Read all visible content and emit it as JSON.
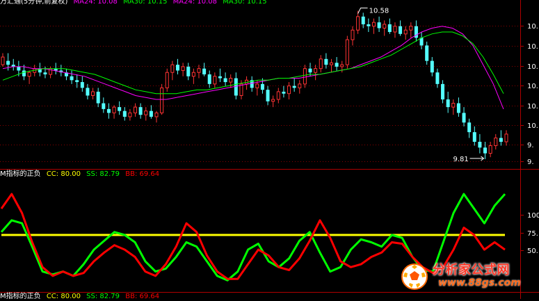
{
  "colors": {
    "up": "#ff3333",
    "down": "#54ffff",
    "ma24": "#ff00ff",
    "ma30": "#00ff00",
    "axis": "#b00000",
    "grid": "#8b0000",
    "cc": "#ffff00",
    "ss": "#00ff00",
    "bb": "#ff0000",
    "label": "#ffffff"
  },
  "price_panel": {
    "title": "万汇通(5分钟,前复权)",
    "legend": [
      {
        "label": "MA24: 10.08",
        "color": "#ff00ff",
        "key": "ma24"
      },
      {
        "label": "MA30: 10.15",
        "color": "#00ff00",
        "key": "ma30"
      },
      {
        "label": "MA24: 10.08",
        "color": "#ff00ff",
        "key": "ma24b"
      },
      {
        "label": "MA30: 10.15",
        "color": "#00ff00",
        "key": "ma30b"
      }
    ],
    "high_label": "10.58",
    "low_label": "9.81"
  },
  "indicator_panel": {
    "title": "M指标的正负",
    "legend": [
      {
        "label": "CC: 80.00",
        "color": "#ffff00"
      },
      {
        "label": "SS: 82.79",
        "color": "#00ff00"
      },
      {
        "label": "BB: 69.64",
        "color": "#ff0000"
      }
    ]
  },
  "bottom_panel": {
    "title": "M指标的正负",
    "legend": [
      {
        "label": "CC: 80.00",
        "color": "#ffff00"
      },
      {
        "label": "SS: 82.79",
        "color": "#00ff00"
      },
      {
        "label": "BB: 69.64",
        "color": "#ff0000"
      }
    ]
  },
  "watermark": {
    "title": "分析家公式网",
    "url": "www.88gs.com"
  },
  "chart_data": [
    {
      "type": "candlestick",
      "title": "万汇通(5分钟,前复权)",
      "yaxis_ticks": [
        "10.",
        "10.",
        "10.",
        "10.",
        "10.",
        "10.",
        "9.",
        "9."
      ],
      "ylim": [
        9.77,
        10.6
      ],
      "candles": [
        [
          10.3,
          10.36,
          10.29,
          10.34
        ],
        [
          10.32,
          10.36,
          10.27,
          10.3
        ],
        [
          10.3,
          10.33,
          10.27,
          10.29
        ],
        [
          10.29,
          10.32,
          10.24,
          10.27
        ],
        [
          10.27,
          10.3,
          10.22,
          10.24
        ],
        [
          10.24,
          10.27,
          10.2,
          10.26
        ],
        [
          10.26,
          10.3,
          10.24,
          10.28
        ],
        [
          10.28,
          10.31,
          10.24,
          10.26
        ],
        [
          10.26,
          10.29,
          10.23,
          10.25
        ],
        [
          10.25,
          10.29,
          10.23,
          10.28
        ],
        [
          10.28,
          10.31,
          10.25,
          10.27
        ],
        [
          10.27,
          10.3,
          10.24,
          10.26
        ],
        [
          10.26,
          10.28,
          10.22,
          10.24
        ],
        [
          10.24,
          10.27,
          10.2,
          10.22
        ],
        [
          10.22,
          10.25,
          10.18,
          10.21
        ],
        [
          10.21,
          10.24,
          10.16,
          10.18
        ],
        [
          10.18,
          10.2,
          10.12,
          10.14
        ],
        [
          10.14,
          10.18,
          10.12,
          10.16
        ],
        [
          10.16,
          10.18,
          10.08,
          10.1
        ],
        [
          10.1,
          10.13,
          10.05,
          10.07
        ],
        [
          10.07,
          10.1,
          10.02,
          10.05
        ],
        [
          10.05,
          10.09,
          10.02,
          10.08
        ],
        [
          10.08,
          10.11,
          10.04,
          10.06
        ],
        [
          10.06,
          10.08,
          10.01,
          10.03
        ],
        [
          10.03,
          10.07,
          10.01,
          10.05
        ],
        [
          10.05,
          10.1,
          10.03,
          10.08
        ],
        [
          10.08,
          10.1,
          10.02,
          10.04
        ],
        [
          10.04,
          10.08,
          10.01,
          10.06
        ],
        [
          10.06,
          10.09,
          10.02,
          10.03
        ],
        [
          10.03,
          10.06,
          10.0,
          10.05
        ],
        [
          10.05,
          10.2,
          10.04,
          10.18
        ],
        [
          10.18,
          10.28,
          10.16,
          10.26
        ],
        [
          10.26,
          10.32,
          10.22,
          10.3
        ],
        [
          10.3,
          10.33,
          10.25,
          10.27
        ],
        [
          10.27,
          10.31,
          10.24,
          10.29
        ],
        [
          10.29,
          10.31,
          10.22,
          10.24
        ],
        [
          10.24,
          10.28,
          10.2,
          10.26
        ],
        [
          10.26,
          10.3,
          10.23,
          10.28
        ],
        [
          10.28,
          10.31,
          10.24,
          10.25
        ],
        [
          10.25,
          10.27,
          10.18,
          10.2
        ],
        [
          10.2,
          10.26,
          10.18,
          10.24
        ],
        [
          10.24,
          10.28,
          10.21,
          10.23
        ],
        [
          10.23,
          10.26,
          10.19,
          10.21
        ],
        [
          10.21,
          10.25,
          10.18,
          10.23
        ],
        [
          10.23,
          10.26,
          10.12,
          10.14
        ],
        [
          10.14,
          10.22,
          10.12,
          10.2
        ],
        [
          10.2,
          10.24,
          10.17,
          10.22
        ],
        [
          10.22,
          10.24,
          10.16,
          10.18
        ],
        [
          10.18,
          10.22,
          10.14,
          10.2
        ],
        [
          10.2,
          10.23,
          10.15,
          10.17
        ],
        [
          10.17,
          10.19,
          10.09,
          10.11
        ],
        [
          10.11,
          10.14,
          10.08,
          10.12
        ],
        [
          10.12,
          10.18,
          10.1,
          10.16
        ],
        [
          10.16,
          10.19,
          10.13,
          10.15
        ],
        [
          10.15,
          10.21,
          10.12,
          10.19
        ],
        [
          10.19,
          10.23,
          10.16,
          10.18
        ],
        [
          10.18,
          10.22,
          10.15,
          10.2
        ],
        [
          10.2,
          10.3,
          10.18,
          10.28
        ],
        [
          10.28,
          10.31,
          10.24,
          10.26
        ],
        [
          10.26,
          10.3,
          10.22,
          10.28
        ],
        [
          10.28,
          10.35,
          10.26,
          10.33
        ],
        [
          10.33,
          10.36,
          10.28,
          10.3
        ],
        [
          10.3,
          10.33,
          10.26,
          10.31
        ],
        [
          10.31,
          10.34,
          10.27,
          10.29
        ],
        [
          10.29,
          10.32,
          10.26,
          10.3
        ],
        [
          10.3,
          10.45,
          10.28,
          10.43
        ],
        [
          10.43,
          10.5,
          10.4,
          10.48
        ],
        [
          10.48,
          10.58,
          10.46,
          10.55
        ],
        [
          10.55,
          10.57,
          10.49,
          10.51
        ],
        [
          10.51,
          10.54,
          10.47,
          10.5
        ],
        [
          10.5,
          10.54,
          10.46,
          10.52
        ],
        [
          10.52,
          10.55,
          10.47,
          10.49
        ],
        [
          10.49,
          10.53,
          10.45,
          10.51
        ],
        [
          10.51,
          10.54,
          10.46,
          10.47
        ],
        [
          10.47,
          10.52,
          10.44,
          10.5
        ],
        [
          10.5,
          10.53,
          10.45,
          10.46
        ],
        [
          10.46,
          10.5,
          10.43,
          10.48
        ],
        [
          10.48,
          10.52,
          10.44,
          10.5
        ],
        [
          10.5,
          10.53,
          10.42,
          10.44
        ],
        [
          10.44,
          10.47,
          10.38,
          10.4
        ],
        [
          10.4,
          10.42,
          10.3,
          10.32
        ],
        [
          10.32,
          10.34,
          10.24,
          10.26
        ],
        [
          10.26,
          10.28,
          10.18,
          10.2
        ],
        [
          10.2,
          10.22,
          10.1,
          10.12
        ],
        [
          10.12,
          10.16,
          10.05,
          10.08
        ],
        [
          10.08,
          10.12,
          10.04,
          10.1
        ],
        [
          10.1,
          10.13,
          10.03,
          10.05
        ],
        [
          10.05,
          10.08,
          9.98,
          10.0
        ],
        [
          10.0,
          10.02,
          9.92,
          9.95
        ],
        [
          9.95,
          9.98,
          9.88,
          9.9
        ],
        [
          9.9,
          9.94,
          9.84,
          9.87
        ],
        [
          9.87,
          9.9,
          9.81,
          9.84
        ],
        [
          9.84,
          9.9,
          9.82,
          9.88
        ],
        [
          9.88,
          9.94,
          9.86,
          9.92
        ],
        [
          9.92,
          9.96,
          9.88,
          9.9
        ],
        [
          9.9,
          9.96,
          9.88,
          9.94
        ]
      ],
      "series": [
        {
          "name": "MA24",
          "values": [
            10.28,
            10.29,
            10.29,
            10.28,
            10.28,
            10.27,
            10.26,
            10.25,
            10.24,
            10.22,
            10.2,
            10.18,
            10.16,
            10.14,
            10.13,
            10.12,
            10.12,
            10.13,
            10.14,
            10.15,
            10.16,
            10.17,
            10.18,
            10.19,
            10.2,
            10.21,
            10.22,
            10.23,
            10.23,
            10.23,
            10.24,
            10.25,
            10.26,
            10.27,
            10.28,
            10.3,
            10.32,
            10.34,
            10.37,
            10.4,
            10.44,
            10.47,
            10.49,
            10.5,
            10.49,
            10.46,
            10.4,
            10.3,
            10.2,
            10.07
          ]
        },
        {
          "name": "MA30",
          "values": [
            10.22,
            10.24,
            10.26,
            10.27,
            10.28,
            10.28,
            10.28,
            10.27,
            10.26,
            10.25,
            10.23,
            10.21,
            10.19,
            10.17,
            10.16,
            10.15,
            10.15,
            10.15,
            10.16,
            10.17,
            10.17,
            10.18,
            10.19,
            10.2,
            10.21,
            10.22,
            10.22,
            10.23,
            10.23,
            10.24,
            10.25,
            10.25,
            10.26,
            10.27,
            10.28,
            10.29,
            10.31,
            10.33,
            10.35,
            10.38,
            10.41,
            10.44,
            10.46,
            10.47,
            10.47,
            10.45,
            10.41,
            10.34,
            10.25,
            10.15
          ]
        }
      ]
    },
    {
      "type": "line",
      "title": "M指标的正负",
      "yaxis_ticks": [
        "100",
        "75.",
        "50."
      ],
      "ylim": [
        42,
        118
      ],
      "series": [
        {
          "name": "CC",
          "values": [
            80,
            80,
            80,
            80,
            80,
            80,
            80,
            80,
            80,
            80,
            80,
            80,
            80,
            80,
            80,
            80,
            80,
            80,
            80,
            80,
            80,
            80,
            80,
            80,
            80,
            80,
            80,
            80,
            80,
            80,
            80,
            80,
            80,
            80,
            80,
            80,
            80,
            80,
            80,
            80,
            80,
            80,
            80,
            80,
            80,
            80,
            80,
            80,
            80,
            80
          ]
        },
        {
          "name": "SS",
          "values": [
            82,
            90,
            88,
            72,
            55,
            53,
            55,
            52,
            60,
            70,
            76,
            82,
            80,
            75,
            62,
            55,
            57,
            65,
            75,
            72,
            62,
            52,
            49,
            55,
            70,
            74,
            62,
            58,
            64,
            76,
            82,
            68,
            55,
            58,
            70,
            77,
            75,
            72,
            80,
            78,
            65,
            56,
            55,
            75,
            95,
            108,
            98,
            88,
            100,
            108
          ]
        },
        {
          "name": "BB",
          "values": [
            98,
            108,
            95,
            75,
            58,
            52,
            55,
            52,
            54,
            62,
            68,
            73,
            70,
            65,
            55,
            52,
            60,
            72,
            88,
            82,
            66,
            55,
            50,
            50,
            60,
            70,
            66,
            58,
            56,
            64,
            76,
            90,
            78,
            62,
            58,
            60,
            65,
            68,
            75,
            74,
            65,
            58,
            54,
            58,
            70,
            85,
            80,
            70,
            75,
            70
          ]
        }
      ]
    }
  ]
}
